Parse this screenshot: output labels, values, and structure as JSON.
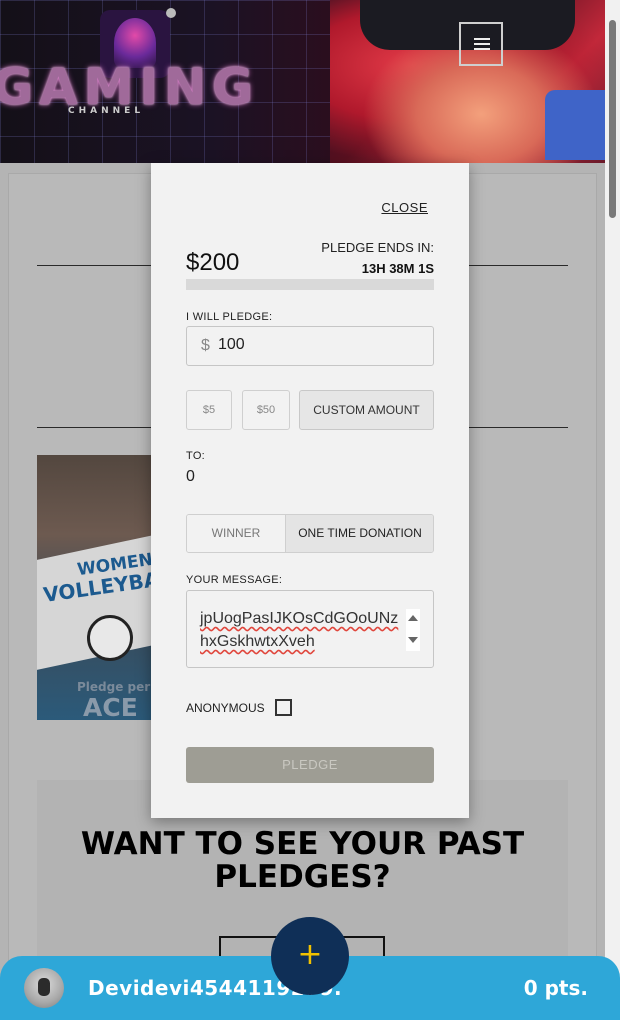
{
  "header": {
    "brand_word": "GAMING",
    "brand_sub": "CHANNEL",
    "logo_text": "GAMING"
  },
  "past_pledges": {
    "title": "WANT TO SEE YOUR PAST PLEDGES?"
  },
  "promo_card": {
    "line1": "WOMEN",
    "line2": "VOLLEYBA",
    "pledge_text": "Pledge per",
    "ace_text": "ACE"
  },
  "modal": {
    "close_label": "CLOSE",
    "amount": "$200",
    "ends_label": "PLEDGE ENDS IN:",
    "ends_value": "13H 38M 1S",
    "progress_fraction": 0.0,
    "pledge_label": "I WILL PLEDGE:",
    "currency_symbol": "$",
    "pledge_value": "100",
    "quick_amounts": [
      "$5",
      "$50"
    ],
    "custom_amount_label": "CUSTOM AMOUNT",
    "to_label": "TO:",
    "to_value": "0",
    "toggle_winner": "WINNER",
    "toggle_donation": "ONE TIME DONATION",
    "message_label": "YOUR MESSAGE:",
    "message_value": "jpUogPasIJKOsCdGOoUNzhxGskhwtxXveh",
    "anonymous_label": "ANONYMOUS",
    "pledge_button": "PLEDGE"
  },
  "bottom_bar": {
    "username": "Devidevi4544119279.",
    "points": "0 pts.",
    "fab_symbol": "+"
  },
  "colors": {
    "accent_blue": "#2ea7d8",
    "fab_navy": "#0f2f57",
    "fab_plus": "#f2c200",
    "pledge_button_bg": "#9e9d94"
  }
}
